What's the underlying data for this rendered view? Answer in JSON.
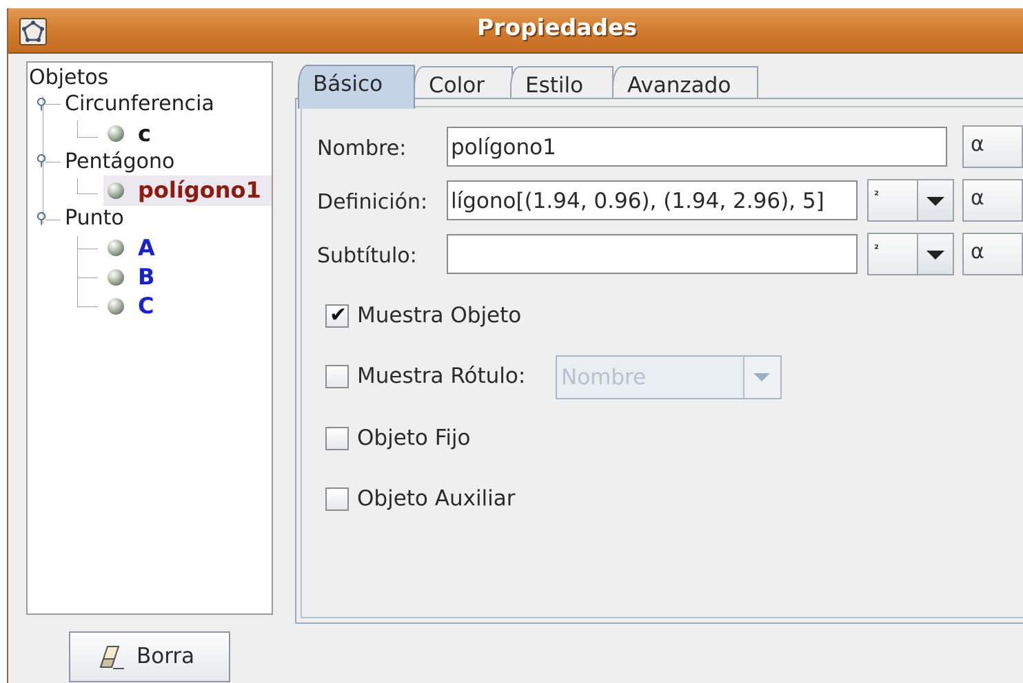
{
  "window": {
    "title": "Propiedades"
  },
  "tree": {
    "root": "Objetos",
    "categories": [
      {
        "label": "Circunferencia",
        "items": [
          "c"
        ]
      },
      {
        "label": "Pentágono",
        "items": [
          "polígono1"
        ]
      },
      {
        "label": "Punto",
        "items": [
          "A",
          "B",
          "C"
        ]
      }
    ],
    "selected": "polígono1"
  },
  "tabs": [
    "Básico",
    "Color",
    "Estilo",
    "Avanzado"
  ],
  "active_tab": "Básico",
  "form": {
    "nombre_label": "Nombre:",
    "nombre_value": "polígono1",
    "definicion_label": "Definición:",
    "definicion_value": "lígono[(1.94, 0.96), (1.94, 2.96), 5]",
    "subtitulo_label": "Subtítulo:",
    "subtitulo_value": "",
    "superscript_symbol": "²",
    "greek_symbol": "α"
  },
  "checkboxes": {
    "muestra_objeto": {
      "label": "Muestra Objeto",
      "checked": true
    },
    "muestra_rotulo": {
      "label": "Muestra Rótulo:",
      "checked": false
    },
    "objeto_fijo": {
      "label": "Objeto Fijo",
      "checked": false
    },
    "objeto_auxiliar": {
      "label": "Objeto Auxiliar",
      "checked": false
    }
  },
  "rotulo_select": {
    "value": "Nombre",
    "enabled": false
  },
  "delete_button": {
    "label": "Borra"
  },
  "check_glyph": "✔"
}
